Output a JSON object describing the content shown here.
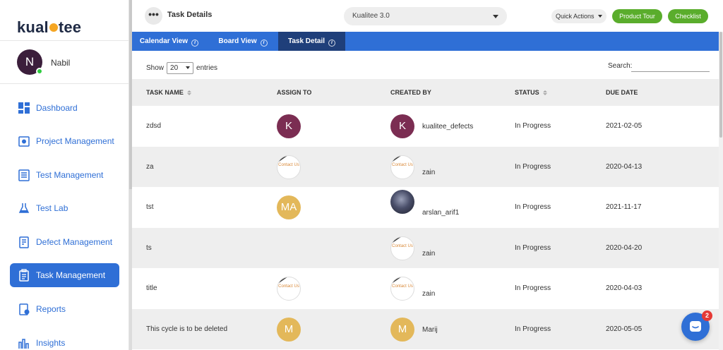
{
  "app": {
    "logo_text_a": "kual",
    "logo_text_b": "tee"
  },
  "user": {
    "initial": "N",
    "name": "Nabil"
  },
  "sidebar": {
    "items": [
      {
        "label": "Dashboard",
        "icon": "dashboard-icon",
        "active": false
      },
      {
        "label": "Project Management",
        "icon": "project-icon",
        "active": false
      },
      {
        "label": "Test Management",
        "icon": "test-management-icon",
        "active": false
      },
      {
        "label": "Test Lab",
        "icon": "flask-icon",
        "active": false
      },
      {
        "label": "Defect Management",
        "icon": "defect-icon",
        "active": false
      },
      {
        "label": "Task Management",
        "icon": "clipboard-icon",
        "active": true
      },
      {
        "label": "Reports",
        "icon": "reports-icon",
        "active": false
      },
      {
        "label": "Insights",
        "icon": "bar-chart-icon",
        "active": false
      }
    ]
  },
  "header": {
    "more_label": "•••",
    "title": "Task Details",
    "project_select": "Kualitee 3.0",
    "quick_actions": "Quick Actions",
    "product_tour": "Product Tour",
    "checklist": "Checklist"
  },
  "tabs": [
    {
      "label": "Calendar View",
      "active": false
    },
    {
      "label": "Board View",
      "active": false
    },
    {
      "label": "Task Detail",
      "active": true
    }
  ],
  "table_controls": {
    "show_label": "Show",
    "entries_value": "20",
    "entries_label": "entries",
    "search_label": "Search:"
  },
  "columns": [
    "TASK NAME",
    "ASSIGN TO",
    "CREATED BY",
    "STATUS",
    "DUE DATE"
  ],
  "contact_text": "Contact Us",
  "rows": [
    {
      "task": "zdsd",
      "assign": {
        "type": "initial",
        "text": "K",
        "color": "#7b2d52"
      },
      "creator": {
        "type": "initial",
        "text": "K",
        "color": "#7b2d52",
        "name": "kualitee_defects"
      },
      "status": "In Progress",
      "due": "2021-02-05"
    },
    {
      "task": "za",
      "assign": {
        "type": "contact"
      },
      "creator": {
        "type": "contact",
        "name": "zain"
      },
      "status": "In Progress",
      "due": "2020-04-13"
    },
    {
      "task": "tst",
      "assign": {
        "type": "initial",
        "text": "MA",
        "color": "#e3b85a"
      },
      "creator": {
        "type": "photo",
        "name": "arslan_arif1"
      },
      "status": "In Progress",
      "due": "2021-11-17"
    },
    {
      "task": "ts",
      "assign": {
        "type": "none"
      },
      "creator": {
        "type": "contact",
        "name": "zain"
      },
      "status": "In Progress",
      "due": "2020-04-20"
    },
    {
      "task": "title",
      "assign": {
        "type": "contact"
      },
      "creator": {
        "type": "contact",
        "name": "zain"
      },
      "status": "In Progress",
      "due": "2020-04-03"
    },
    {
      "task": "This cycle is to be deleted",
      "assign": {
        "type": "initial",
        "text": "M",
        "color": "#e3b85a"
      },
      "creator": {
        "type": "initial",
        "text": "M",
        "color": "#e3b85a",
        "name": "Marij"
      },
      "status": "In Progress",
      "due": "2020-05-05"
    }
  ],
  "chat": {
    "badge_count": "2"
  },
  "colors": {
    "primary": "#2f6fd6",
    "green": "#5aad2c",
    "active_tab": "#1f3f7a"
  }
}
